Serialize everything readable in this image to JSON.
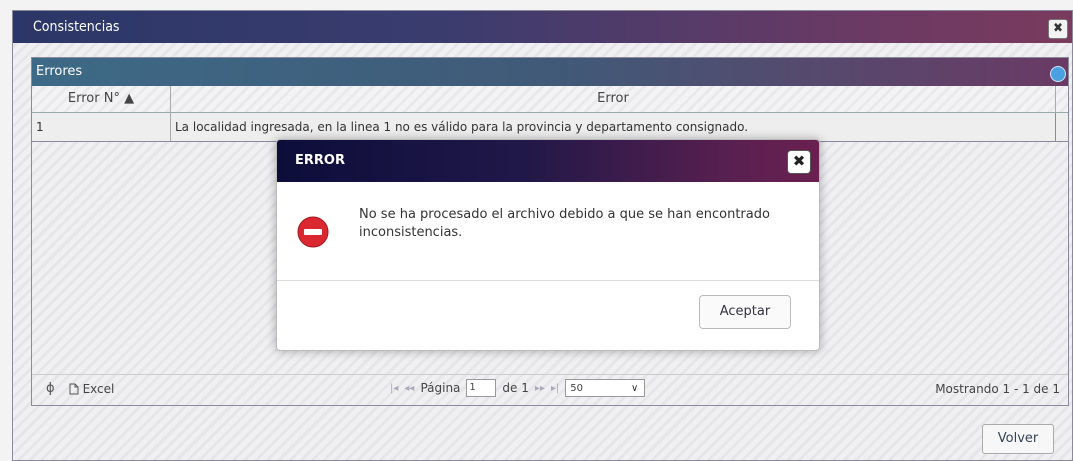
{
  "window": {
    "title": "Consistencias",
    "close_symbol": "✖"
  },
  "panel": {
    "title": "Errores",
    "columns": [
      "Error N° ▲",
      "Error"
    ],
    "rows": [
      {
        "num": "1",
        "error": "La localidad ingresada, en la linea 1 no es válido para la provincia y departamento consignado."
      }
    ],
    "refresh_icon": "ϕ",
    "excel_label": "Excel",
    "page_label": "Página",
    "page_value": "1",
    "of_label": "de 1",
    "page_size": "50",
    "showing": "Mostrando 1 - 1 de 1"
  },
  "buttons": {
    "volver": "Volver"
  },
  "dialog": {
    "title": "ERROR",
    "close_symbol": "✖",
    "message": "No se ha procesado el archivo debido a que se han encontrado inconsistencias.",
    "accept": "Aceptar"
  },
  "colors": {
    "dialog_icon": "#d9282f"
  }
}
